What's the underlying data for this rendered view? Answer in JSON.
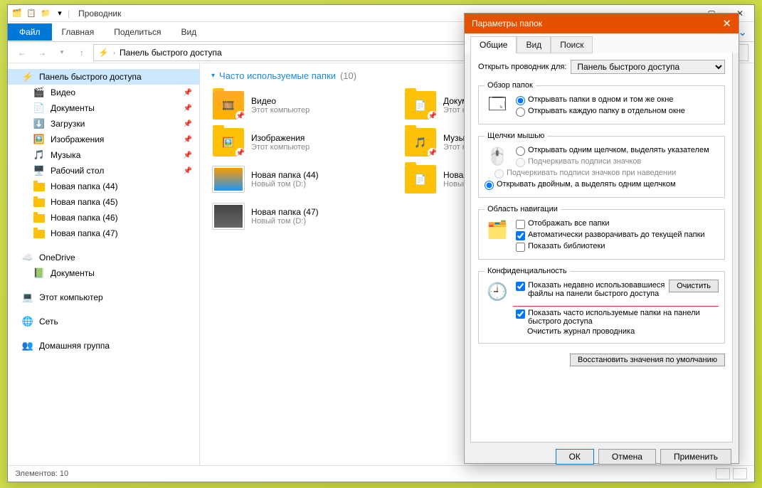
{
  "window": {
    "title": "Проводник",
    "ribbon": {
      "file": "Файл",
      "home": "Главная",
      "share": "Поделиться",
      "view": "Вид"
    },
    "address": "Панель быстрого доступа",
    "status": "Элементов: 10"
  },
  "sidebar": {
    "quick": "Панель быстрого доступа",
    "items": [
      "Видео",
      "Документы",
      "Загрузки",
      "Изображения",
      "Музыка",
      "Рабочий стол",
      "Новая папка (44)",
      "Новая папка (45)",
      "Новая папка (46)",
      "Новая папка (47)"
    ],
    "onedrive": "OneDrive",
    "onedrive_docs": "Документы",
    "thispc": "Этот компьютер",
    "network": "Сеть",
    "homegroup": "Домашняя группа"
  },
  "section": {
    "title": "Часто используемые папки",
    "count": "(10)"
  },
  "files": [
    {
      "name": "Видео",
      "loc": "Этот компьютер"
    },
    {
      "name": "Докуме",
      "loc": "Этот ко"
    },
    {
      "name": "Изображения",
      "loc": "Этот компьютер"
    },
    {
      "name": "Музыка",
      "loc": "Этот ко"
    },
    {
      "name": "Новая папка (44)",
      "loc": "Новый том (D:)"
    },
    {
      "name": "Новая п",
      "loc": "Новый"
    },
    {
      "name": "Новая папка (47)",
      "loc": "Новый том (D:)"
    }
  ],
  "dialog": {
    "title": "Параметры папок",
    "tabs": {
      "general": "Общие",
      "view": "Вид",
      "search": "Поиск"
    },
    "open_label": "Открыть проводник для:",
    "open_value": "Панель быстрого доступа",
    "browse_legend": "Обзор папок",
    "browse_opt1": "Открывать папки в одном и том же окне",
    "browse_opt2": "Открывать каждую папку в отдельном окне",
    "click_legend": "Щелчки мышью",
    "click_opt1": "Открывать одним щелчком, выделять указателем",
    "click_opt1a": "Подчеркивать подписи значков",
    "click_opt1b": "Подчеркивать подписи значков при наведении",
    "click_opt2": "Открывать двойным, а выделять одним щелчком",
    "nav_legend": "Область навигации",
    "nav_opt1": "Отображать все папки",
    "nav_opt2": "Автоматически разворачивать до текущей папки",
    "nav_opt3": "Показать библиотеки",
    "privacy_legend": "Конфиденциальность",
    "privacy_opt1": "Показать недавно использовавшиеся файлы на панели быстрого доступа",
    "privacy_opt2": "Показать часто используемые папки на панели быстрого доступа",
    "privacy_clear_label": "Очистить журнал проводника",
    "clear_btn": "Очистить",
    "restore": "Восстановить значения по умолчанию",
    "ok": "ОК",
    "cancel": "Отмена",
    "apply": "Применить"
  }
}
